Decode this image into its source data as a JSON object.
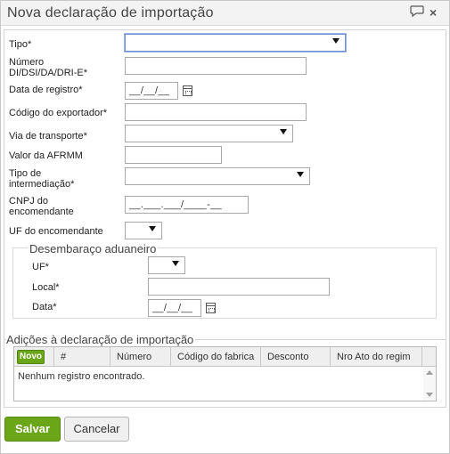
{
  "dialog": {
    "title": "Nova declaração de importação"
  },
  "fields": {
    "tipo_label": "Tipo*",
    "numero_label_1": "Número",
    "numero_label_2": "DI/DSI/DA/DRI-E*",
    "data_registro_label": "Data de registro*",
    "data_registro_mask": "__/__/__",
    "codigo_exportador_label": "Código do exportador*",
    "via_transporte_label": "Via de transporte*",
    "valor_afrmm_label": "Valor da AFRMM",
    "tipo_intermediacao_label_1": "Tipo de",
    "tipo_intermediacao_label_2": "intermediação*",
    "cnpj_label_1": "CNPJ do",
    "cnpj_label_2": "encomendante",
    "cnpj_mask": "__.___.___/____-__",
    "uf_encomendante_label": "UF do encomendante"
  },
  "desembaraco": {
    "legend": "Desembaraço aduaneiro",
    "uf_label": "UF*",
    "local_label": "Local*",
    "data_label": "Data*",
    "data_mask": "__/__/__"
  },
  "adicoes": {
    "title": "Adições à declaração de importação",
    "novo_label": "Novo",
    "columns": [
      "#",
      "Número",
      "Código do fabrica",
      "Desconto",
      "Nro Ato do regim"
    ],
    "empty_text": "Nenhum registro encontrado."
  },
  "buttons": {
    "save": "Salvar",
    "cancel": "Cancelar"
  },
  "colors": {
    "accent_green": "#6aa617",
    "focus_blue": "#6d8fd0"
  }
}
